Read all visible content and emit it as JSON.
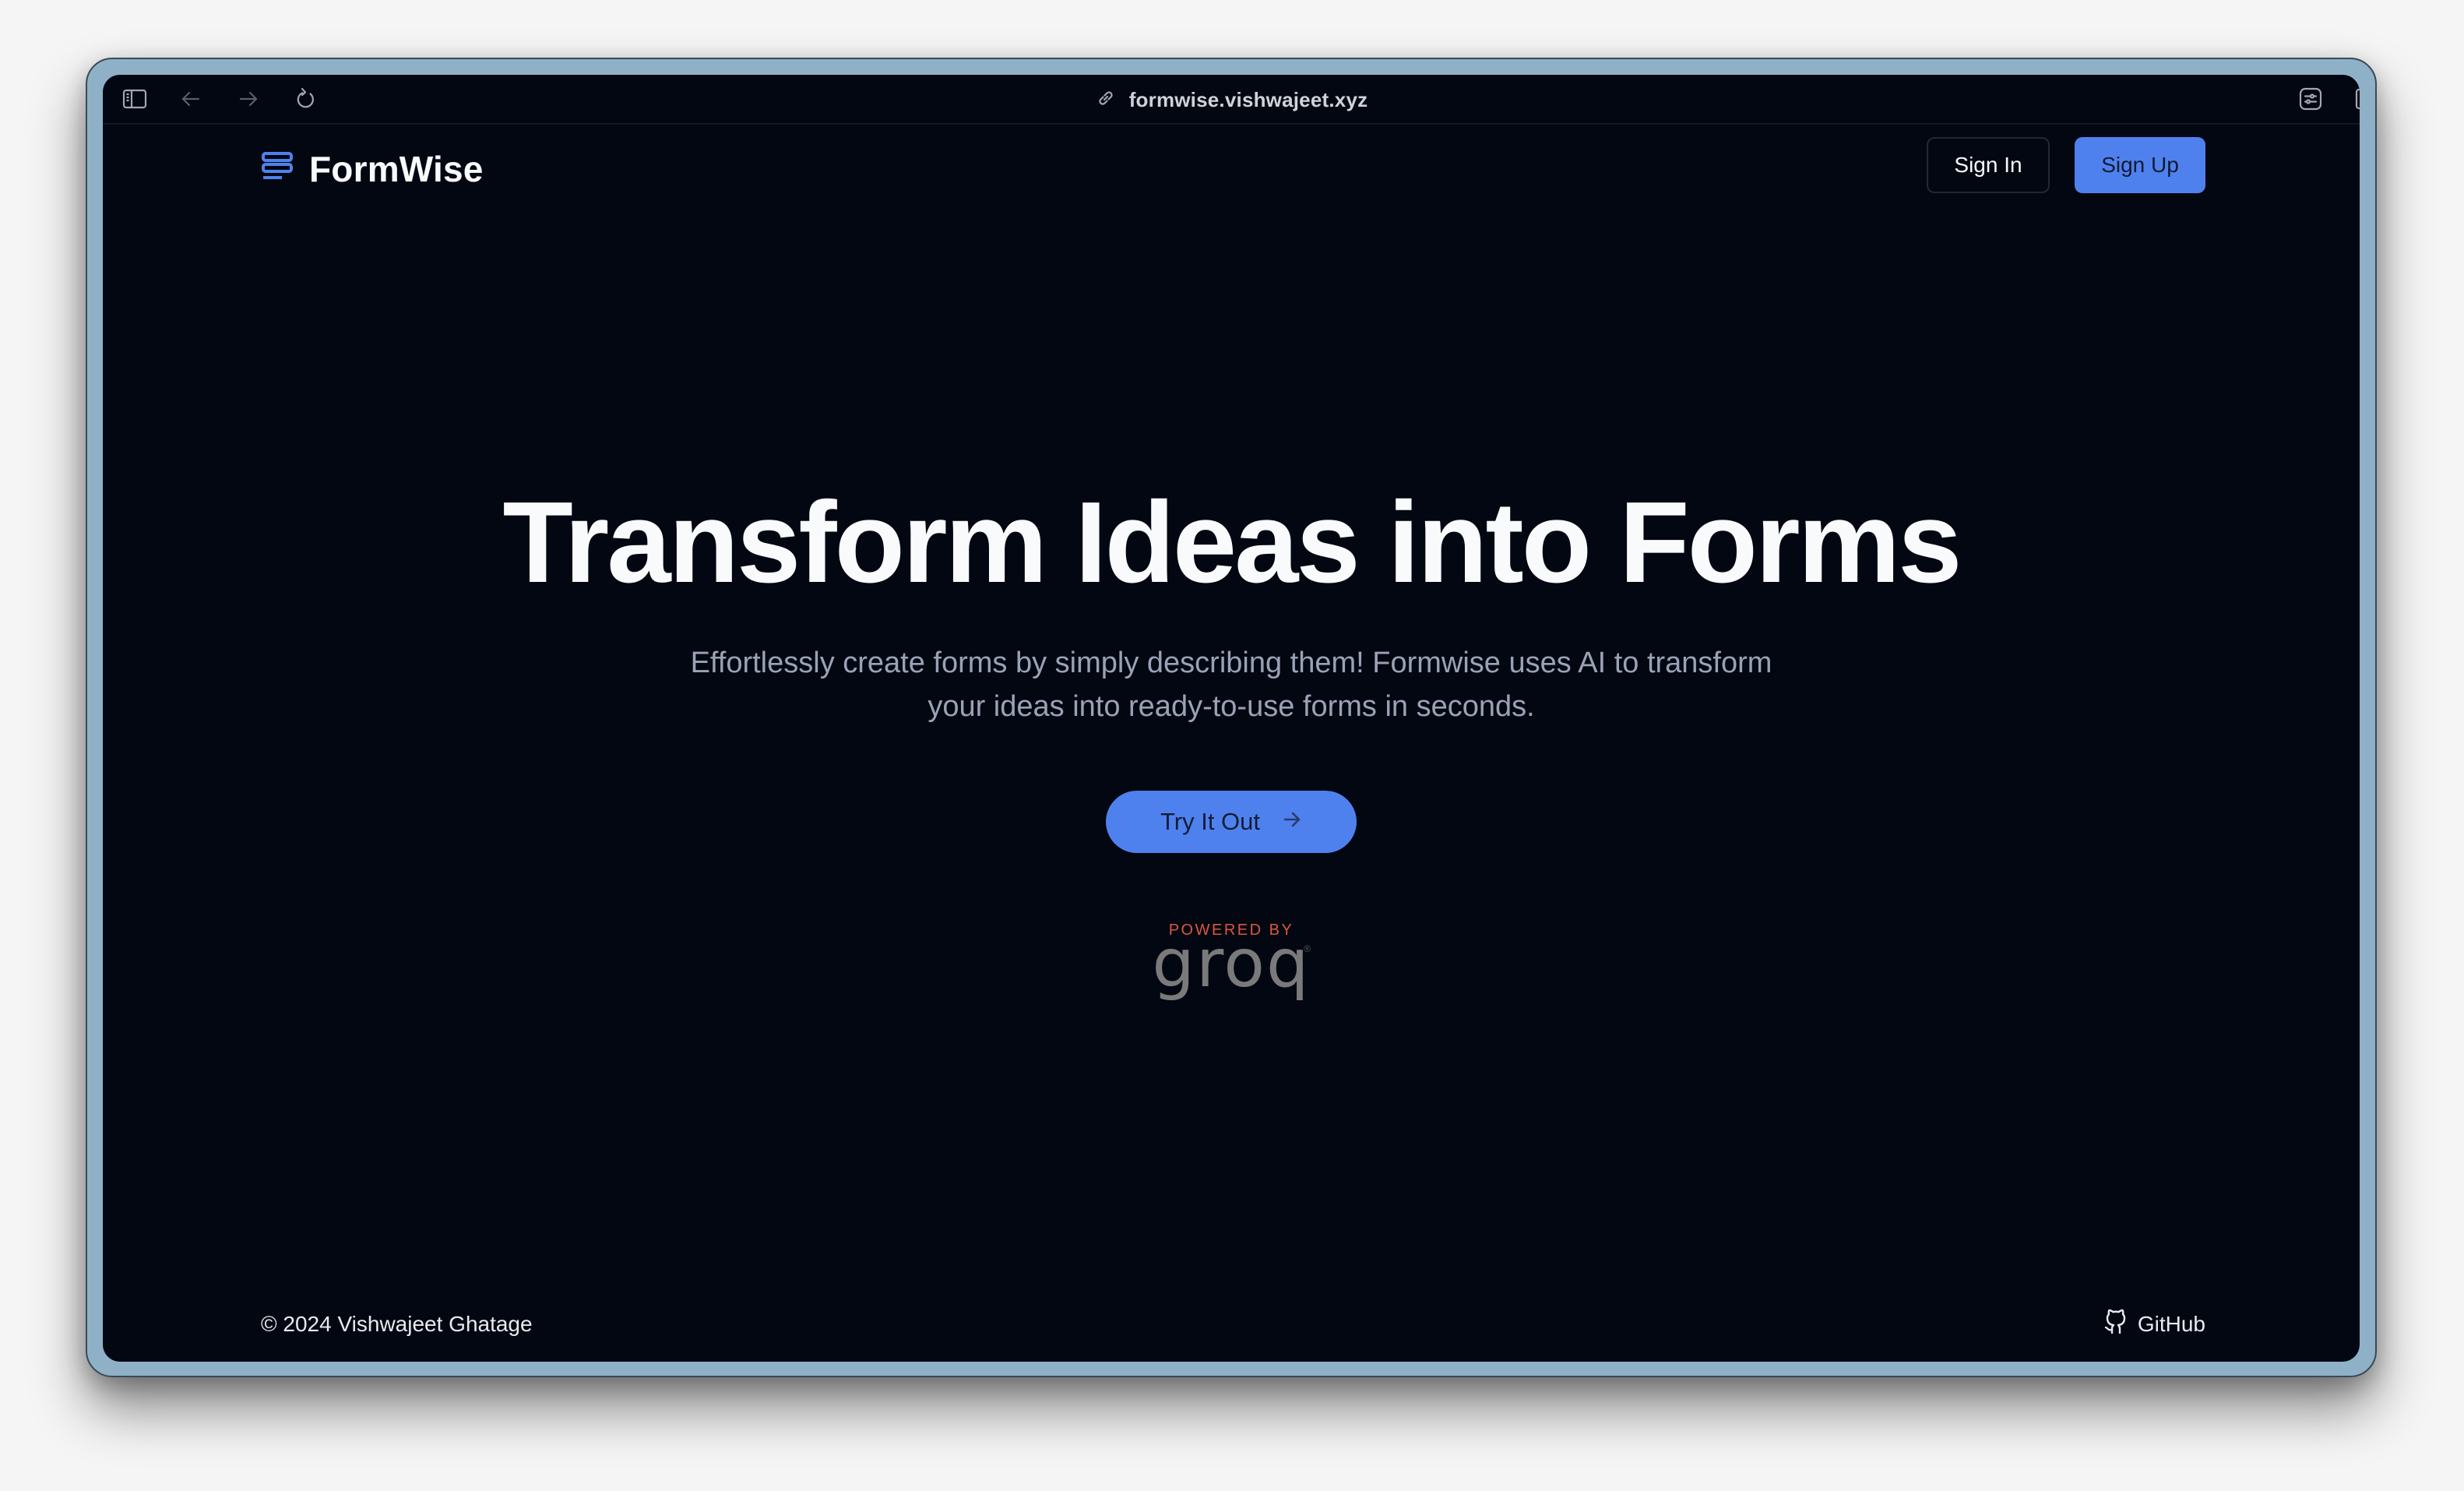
{
  "browser": {
    "url": "formwise.vishwajeet.xyz",
    "icons": {
      "sidebar": "sidebar-icon",
      "back": "arrow-left-icon",
      "forward": "arrow-right-icon",
      "reload": "reload-icon",
      "link": "link-icon",
      "extensions": "sliders-icon",
      "split_view": "split-view-icon"
    }
  },
  "nav": {
    "brand": "FormWise",
    "brand_color": "#4f81ee",
    "sign_in_label": "Sign In",
    "sign_up_label": "Sign Up"
  },
  "hero": {
    "title": "Transform Ideas into Forms",
    "subtitle": "Effortlessly create forms by simply describing them! Formwise uses AI to transform your ideas into ready-to-use forms in seconds.",
    "cta_label": "Try It Out",
    "cta_icon": "arrow-right-icon",
    "accent_color": "#4f81ee"
  },
  "powered_by": {
    "label": "POWERED BY",
    "brand": "groq",
    "trademark": "®",
    "label_color": "#d9573f"
  },
  "footer": {
    "copyright": "© 2024 Vishwajeet Ghatage",
    "github_label": "GitHub",
    "github_icon": "github-icon"
  },
  "colors": {
    "page_background": "#030712",
    "frame": "#8fb1c8"
  }
}
